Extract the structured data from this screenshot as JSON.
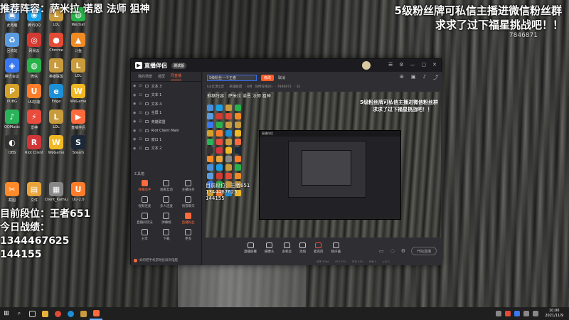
{
  "overlay": {
    "top_left": "推荐阵容：萨米拉 诺恩 法师 狙神",
    "top_right_line1": "5级粉丝牌可私信主播进微信粉丝群",
    "top_right_line2": "求求了过下福星挑战吧！！",
    "room_id": "7846871",
    "rank_line": "目前段位：王者651",
    "today_line": "今日战绩：",
    "stat1": "1344467625",
    "stat2": "144155"
  },
  "desktop_icons": [
    {
      "label": "此电脑",
      "color": "#4a90d9",
      "glyph": "▣"
    },
    {
      "label": "腾讯QQ",
      "color": "#1aa0e8",
      "glyph": "◉"
    },
    {
      "label": "LOL",
      "color": "#c89b3c",
      "glyph": "L"
    },
    {
      "label": "Wechat",
      "color": "#27b24a",
      "glyph": "◍"
    },
    {
      "label": "回收站",
      "color": "#5b9be0",
      "glyph": "♻"
    },
    {
      "label": "网易云",
      "color": "#d33a32",
      "glyph": "◎"
    },
    {
      "label": "Chrome",
      "color": "#e34b35",
      "glyph": "●"
    },
    {
      "label": "斗鱼",
      "color": "#f08a24",
      "glyph": "▲"
    },
    {
      "label": "腾讯会议",
      "color": "#3a78f2",
      "glyph": "◈"
    },
    {
      "label": "微信",
      "color": "#2ab24a",
      "glyph": "◍"
    },
    {
      "label": "英雄联盟",
      "color": "#c89b3c",
      "glyph": "L"
    },
    {
      "label": "LOL",
      "color": "#c89b3c",
      "glyph": "L"
    },
    {
      "label": "PUBG",
      "color": "#d4a12a",
      "glyph": "P"
    },
    {
      "label": "UU加速",
      "color": "#ff7d2a",
      "glyph": "U"
    },
    {
      "label": "Edge",
      "color": "#1d8fd6",
      "glyph": "e"
    },
    {
      "label": "WeGame",
      "color": "#f0b824",
      "glyph": "W"
    },
    {
      "label": "QQMusic",
      "color": "#2bb35b",
      "glyph": "♪"
    },
    {
      "label": "雷神",
      "color": "#e94b3c",
      "glyph": "⚡"
    },
    {
      "label": "LOL",
      "color": "#c89b3c",
      "glyph": "L"
    },
    {
      "label": "直播伴侣",
      "color": "#ff6a3d",
      "glyph": "▶"
    },
    {
      "label": "OBS",
      "color": "#333",
      "glyph": "◐"
    },
    {
      "label": "Riot Client",
      "color": "#d13639",
      "glyph": "R"
    },
    {
      "label": "WeGame",
      "color": "#f0b824",
      "glyph": "W"
    },
    {
      "label": "Steam",
      "color": "#1b2838",
      "glyph": "S"
    },
    {
      "label": "截图",
      "color": "#ff8a2a",
      "glyph": "✂"
    },
    {
      "label": "文件",
      "color": "#e8a43a",
      "glyph": "▤"
    },
    {
      "label": "Client_Kamiu",
      "color": "#888",
      "glyph": "▦"
    },
    {
      "label": "UU-2.0",
      "color": "#ff7d2a",
      "glyph": "U"
    }
  ],
  "app": {
    "name": "直播伴侣",
    "version_badge": "测试版",
    "tabs": [
      "我的场景",
      "竖屏",
      "同直播"
    ],
    "scenes": [
      "文本 3",
      "文本 1",
      "文本 4",
      "全屏 1",
      "英雄联盟",
      "Riot Client Main",
      "窗口 1",
      "文本 2"
    ],
    "tools_title": "工具箱",
    "tools": [
      {
        "label": "弹幕助手",
        "active": true
      },
      {
        "label": "观看互动",
        "active": false
      },
      {
        "label": "主播任务",
        "active": false
      },
      {
        "label": "视频连麦",
        "active": false
      },
      {
        "label": "多人连麦",
        "active": false
      },
      {
        "label": "语音聊天",
        "active": false
      },
      {
        "label": "直播间玩法",
        "active": false
      },
      {
        "label": "弹幕姬",
        "active": false
      },
      {
        "label": "直播粉丝",
        "active": true
      },
      {
        "label": "分享",
        "active": false
      },
      {
        "label": "下载",
        "active": false
      },
      {
        "label": "更多",
        "active": false
      }
    ],
    "footer_tip": "如何把手机游戏投屏到电脑",
    "title_input_value": "5级粉丝一个王者",
    "edit_label": "修改",
    "cancel_label": "取消",
    "sub_items": [
      "Lol云顶之弈",
      "· 英雄联盟",
      "· 8月",
      "同时在线(0)",
      "· 7846871",
      "· 32"
    ],
    "controls": [
      "直播屏幕",
      "摄像头",
      "多机位",
      "添加",
      "麦克风",
      "扬声器"
    ],
    "start_label": "开始直播",
    "status": [
      "帧率 30fps",
      "CPU 33%",
      "内存 54%",
      "丢帧 0",
      "上行 0"
    ]
  },
  "taskbar": {
    "time": "10:00",
    "date": "2021/11/9"
  }
}
